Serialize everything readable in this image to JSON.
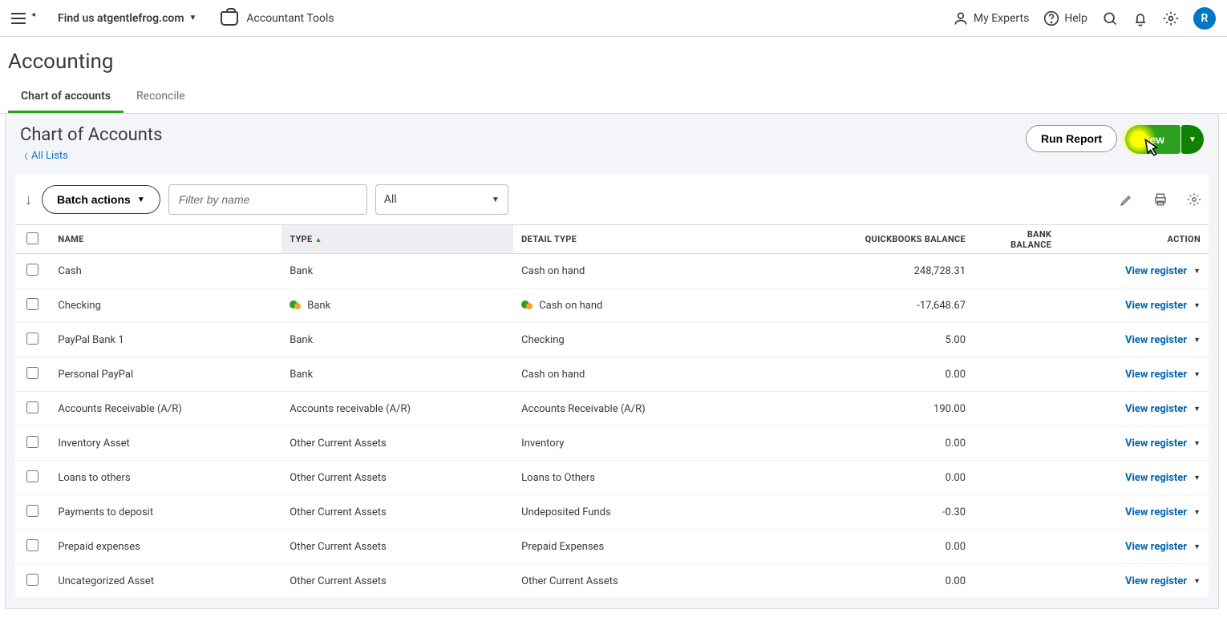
{
  "topbar": {
    "company_prefix": "Find us at ",
    "company_domain": "gentlefrog.com",
    "accountant_tools": "Accountant Tools",
    "my_experts": "My Experts",
    "help": "Help",
    "avatar_initial": "R"
  },
  "page": {
    "title": "Accounting"
  },
  "tabs": [
    {
      "label": "Chart of accounts",
      "active": true
    },
    {
      "label": "Reconcile",
      "active": false
    }
  ],
  "panel": {
    "title": "Chart of Accounts",
    "all_lists": "All Lists",
    "run_report": "Run Report",
    "new_button": "New"
  },
  "toolbar": {
    "batch_actions": "Batch actions",
    "filter_placeholder": "Filter by name",
    "dropdown_value": "All"
  },
  "columns": {
    "name": "NAME",
    "type": "TYPE",
    "detail_type": "DETAIL TYPE",
    "qb_balance": "QUICKBOOKS BALANCE",
    "bank_balance": "BANK BALANCE",
    "action": "ACTION"
  },
  "action_label": "View register",
  "rows": [
    {
      "name": "Cash",
      "type": "Bank",
      "detail": "Cash on hand",
      "qb": "248,728.31",
      "bank": "",
      "icon": false
    },
    {
      "name": "Checking",
      "type": "Bank",
      "detail": "Cash on hand",
      "qb": "-17,648.67",
      "bank": "",
      "icon": true
    },
    {
      "name": "PayPal Bank 1",
      "type": "Bank",
      "detail": "Checking",
      "qb": "5.00",
      "bank": "",
      "icon": false
    },
    {
      "name": "Personal PayPal",
      "type": "Bank",
      "detail": "Cash on hand",
      "qb": "0.00",
      "bank": "",
      "icon": false
    },
    {
      "name": "Accounts Receivable (A/R)",
      "type": "Accounts receivable (A/R)",
      "detail": "Accounts Receivable (A/R)",
      "qb": "190.00",
      "bank": "",
      "icon": false
    },
    {
      "name": "Inventory Asset",
      "type": "Other Current Assets",
      "detail": "Inventory",
      "qb": "0.00",
      "bank": "",
      "icon": false
    },
    {
      "name": "Loans to others",
      "type": "Other Current Assets",
      "detail": "Loans to Others",
      "qb": "0.00",
      "bank": "",
      "icon": false
    },
    {
      "name": "Payments to deposit",
      "type": "Other Current Assets",
      "detail": "Undeposited Funds",
      "qb": "-0.30",
      "bank": "",
      "icon": false
    },
    {
      "name": "Prepaid expenses",
      "type": "Other Current Assets",
      "detail": "Prepaid Expenses",
      "qb": "0.00",
      "bank": "",
      "icon": false
    },
    {
      "name": "Uncategorized Asset",
      "type": "Other Current Assets",
      "detail": "Other Current Assets",
      "qb": "0.00",
      "bank": "",
      "icon": false
    }
  ]
}
